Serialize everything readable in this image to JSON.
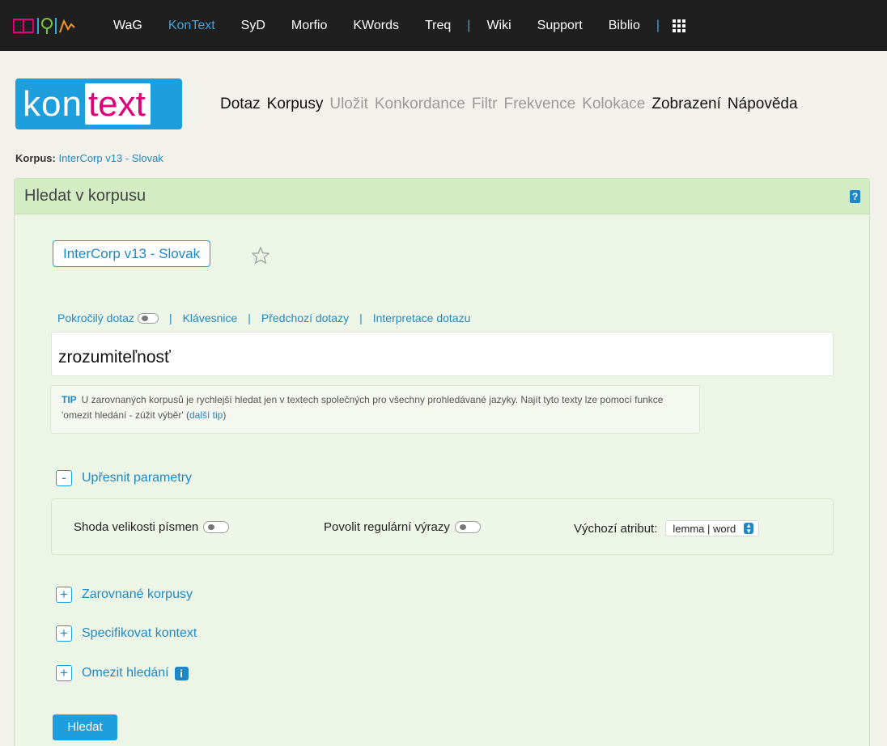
{
  "topbar": {
    "items": [
      {
        "label": "WaG",
        "active": false
      },
      {
        "label": "KonText",
        "active": true
      },
      {
        "label": "SyD",
        "active": false
      },
      {
        "label": "Morfio",
        "active": false
      },
      {
        "label": "KWords",
        "active": false
      },
      {
        "label": "Treq",
        "active": false
      }
    ],
    "items2": [
      {
        "label": "Wiki"
      },
      {
        "label": "Support"
      },
      {
        "label": "Biblio"
      }
    ],
    "separator": "|",
    "accent": "#3fa6dc"
  },
  "brand": {
    "part1": "kon",
    "part2": "text",
    "color": "#1e9fdd",
    "accent": "#e2007a"
  },
  "menu": [
    {
      "label": "Dotaz",
      "enabled": true
    },
    {
      "label": "Korpusy",
      "enabled": true
    },
    {
      "label": "Uložit",
      "enabled": false
    },
    {
      "label": "Konkordance",
      "enabled": false
    },
    {
      "label": "Filtr",
      "enabled": false
    },
    {
      "label": "Frekvence",
      "enabled": false
    },
    {
      "label": "Kolokace",
      "enabled": false
    },
    {
      "label": "Zobrazení",
      "enabled": true
    },
    {
      "label": "Nápověda",
      "enabled": true
    }
  ],
  "corpus_line": {
    "label": "Korpus:",
    "value": "InterCorp v13 - Slovak"
  },
  "panel": {
    "title": "Hledat v korpusu",
    "help_glyph": "?",
    "corpus_button": "InterCorp v13 - Slovak",
    "links": {
      "advanced": "Pokročilý dotaz",
      "keyboard": "Klávesnice",
      "history": "Předchozí dotazy",
      "interpret": "Interpretace dotazu"
    },
    "query_value": "zrozumiteľnosť",
    "tip": {
      "label": "TIP",
      "text": "U zarovnaných korpusů je rychlejší hledat jen v textech společných pro všechny prohledávané jazyky. Najít tyto texty lze pomocí funkce 'omezit hledání - zúžit výběr'",
      "link": "další tip",
      "open": "(",
      "close": ")"
    },
    "refine": {
      "toggle": "-",
      "label": "Upřesnit parametry"
    },
    "params": {
      "case": "Shoda velikosti písmen",
      "regex": "Povolit regulární výrazy",
      "attr_label": "Výchozí atribut:",
      "attr_value": "lemma | word"
    },
    "sections": [
      {
        "toggle": "+",
        "label": "Zarovnané korpusy"
      },
      {
        "toggle": "+",
        "label": "Specifikovat kontext"
      },
      {
        "toggle": "+",
        "label": "Omezit hledání"
      }
    ],
    "info_glyph": "i",
    "search_button": "Hledat"
  }
}
